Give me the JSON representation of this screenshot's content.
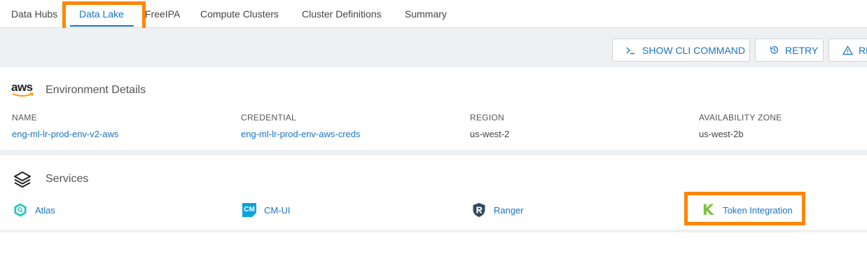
{
  "tabs": [
    "Data Hubs",
    "Data Lake",
    "FreeIPA",
    "Compute Clusters",
    "Cluster Definitions",
    "Summary"
  ],
  "active_tab": "Data Lake",
  "toolbar": {
    "show_cli_label": "SHOW CLI COMMAND",
    "retry_label": "RETRY",
    "third_label": "RE"
  },
  "environment": {
    "provider_logo_text": "aws",
    "title": "Environment Details",
    "fields": [
      {
        "label": "NAME",
        "value": "eng-ml-lr-prod-env-v2-aws"
      },
      {
        "label": "CREDENTIAL",
        "value": "eng-ml-lr-prod-env-aws-creds"
      },
      {
        "label": "REGION",
        "value": "us-west-2"
      },
      {
        "label": "AVAILABILITY ZONE",
        "value": "us-west-2b"
      }
    ]
  },
  "services": {
    "title": "Services",
    "items": [
      {
        "label": "Atlas",
        "icon": "atlas-icon"
      },
      {
        "label": "CM-UI",
        "icon": "cm-icon",
        "icon_text": "CM"
      },
      {
        "label": "Ranger",
        "icon": "ranger-icon"
      },
      {
        "label": "Token Integration",
        "icon": "token-integration-icon",
        "icon_text": "K"
      }
    ]
  },
  "colors": {
    "link": "#1a73c8",
    "highlight": "#ff8500",
    "background_strip": "#eef0f2"
  }
}
